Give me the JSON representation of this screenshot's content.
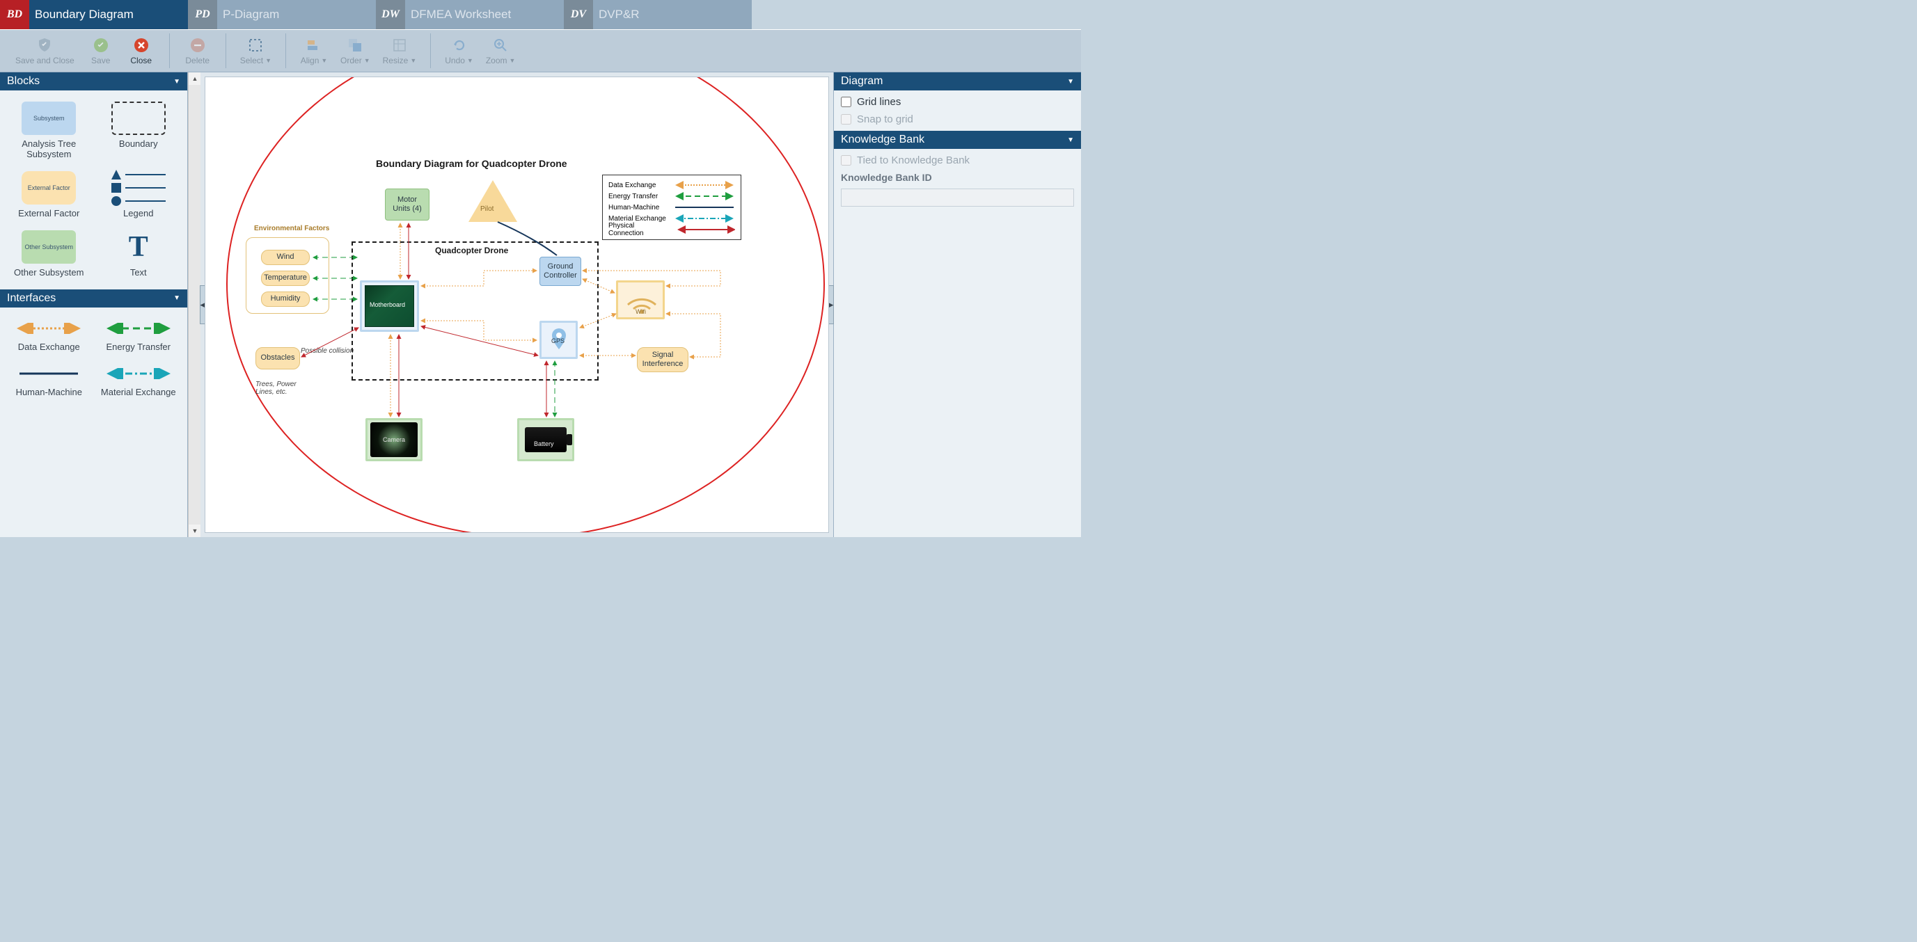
{
  "tabs": [
    {
      "badge": "BD",
      "label": "Boundary Diagram",
      "active": true
    },
    {
      "badge": "PD",
      "label": "P-Diagram",
      "active": false
    },
    {
      "badge": "DW",
      "label": "DFMEA Worksheet",
      "active": false
    },
    {
      "badge": "DV",
      "label": "DVP&R",
      "active": false
    }
  ],
  "ribbon": {
    "save_close": "Save and Close",
    "save": "Save",
    "close": "Close",
    "delete": "Delete",
    "select": "Select",
    "align": "Align",
    "order": "Order",
    "resize": "Resize",
    "undo": "Undo",
    "zoom": "Zoom"
  },
  "left": {
    "blocks_title": "Blocks",
    "interfaces_title": "Interfaces",
    "items": {
      "subsystem_shape": "Subsystem",
      "subsystem": "Analysis Tree Subsystem",
      "boundary": "Boundary",
      "extfactor_shape": "External Factor",
      "extfactor": "External Factor",
      "legend": "Legend",
      "othersub_shape": "Other Subsystem",
      "othersub": "Other Subsystem",
      "text": "Text",
      "data_exchange": "Data Exchange",
      "energy_transfer": "Energy Transfer",
      "human_machine": "Human-Machine",
      "material_exchange": "Material Exchange"
    }
  },
  "right": {
    "diagram_title": "Diagram",
    "grid_lines": "Grid lines",
    "snap_grid": "Snap to grid",
    "kb_title": "Knowledge Bank",
    "kb_tied": "Tied to Knowledge Bank",
    "kb_id_label": "Knowledge Bank ID"
  },
  "diagram": {
    "title": "Boundary Diagram for Quadcopter Drone",
    "boundary_label": "Quadcopter Drone",
    "env_group": "Environmental Factors",
    "nodes": {
      "motor": "Motor Units (4)",
      "pilot": "Pilot",
      "ground": "Ground Controller",
      "mboard": "Motherboard",
      "gps": "GPS",
      "wifi": "Wifi",
      "sigint": "Signal Interference",
      "camera": "Camera",
      "battery": "Battery",
      "obstacles": "Obstacles",
      "wind": "Wind",
      "temp": "Temperature",
      "humidity": "Humidity"
    },
    "notes": {
      "collision": "Possible collision",
      "trees": "Trees, Power Lines, etc."
    },
    "legend": {
      "data": "Data Exchange",
      "energy": "Energy Transfer",
      "human": "Human-Machine",
      "material": "Material Exchange",
      "physical": "Physical Connection"
    }
  }
}
